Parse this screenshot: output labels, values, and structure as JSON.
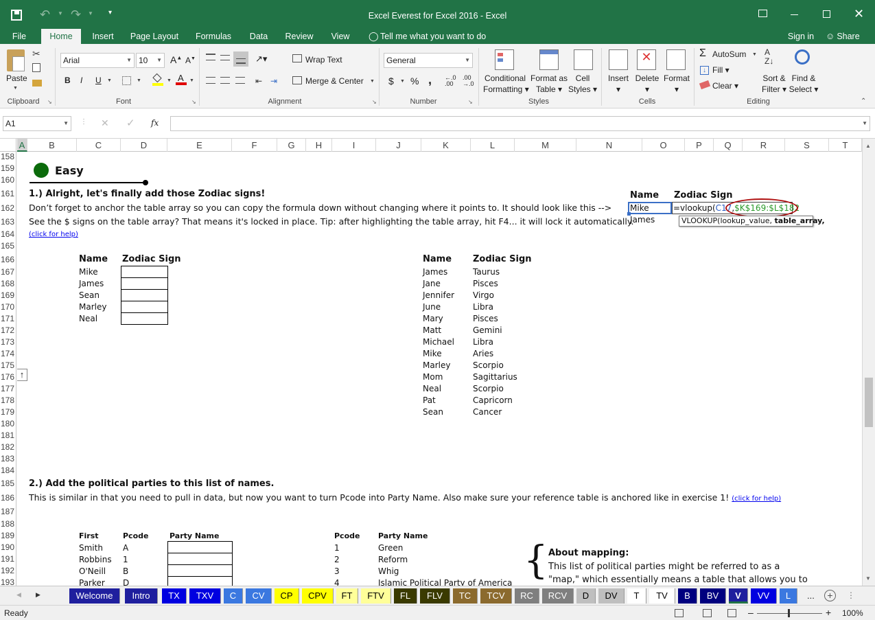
{
  "window": {
    "title": "Excel Everest for Excel 2016 - Excel"
  },
  "ribbon_tabs": [
    "File",
    "Home",
    "Insert",
    "Page Layout",
    "Formulas",
    "Data",
    "Review",
    "View"
  ],
  "tell_me": "Tell me what you want to do",
  "sign_in": "Sign in",
  "share": "Share",
  "clipboard": {
    "paste": "Paste",
    "label": "Clipboard"
  },
  "font": {
    "name": "Arial",
    "size": "10",
    "label": "Font",
    "bold": "B",
    "italic": "I",
    "underline": "U"
  },
  "alignment": {
    "wrap": "Wrap Text",
    "merge": "Merge & Center",
    "label": "Alignment"
  },
  "number": {
    "format": "General",
    "label": "Number",
    "dollar": "$",
    "percent": "%",
    "comma": ","
  },
  "styles": {
    "cond1": "Conditional",
    "cond2": "Formatting",
    "fmt1": "Format as",
    "fmt2": "Table",
    "cell1": "Cell",
    "cell2": "Styles",
    "label": "Styles"
  },
  "cells": {
    "insert": "Insert",
    "delete": "Delete",
    "format": "Format",
    "label": "Cells"
  },
  "editing": {
    "autosum": "AutoSum",
    "fill": "Fill",
    "clear": "Clear",
    "sort1": "Sort &",
    "sort2": "Filter",
    "find1": "Find &",
    "find2": "Select",
    "label": "Editing"
  },
  "formula_bar": {
    "name_box": "A1",
    "fx": "fx",
    "value": ""
  },
  "columns": [
    "A",
    "B",
    "C",
    "D",
    "E",
    "F",
    "G",
    "H",
    "I",
    "J",
    "K",
    "L",
    "M",
    "N",
    "O",
    "P",
    "Q",
    "R",
    "S",
    "T"
  ],
  "rows": [
    "158",
    "159",
    "160",
    "161",
    "162",
    "163",
    "164",
    "165",
    "166",
    "167",
    "168",
    "169",
    "170",
    "171",
    "172",
    "173",
    "174",
    "175",
    "176",
    "177",
    "178",
    "179",
    "180",
    "181",
    "182",
    "183",
    "184",
    "185",
    "186",
    "187",
    "188",
    "189",
    "190",
    "191",
    "192",
    "193"
  ],
  "content": {
    "easy": "Easy",
    "q1_title": "1.) Alright, let's finally add those Zodiac signs!",
    "q1_line1": "Don’t forget to anchor the table array so you can copy the formula down without changing where it points to. It should look like this -->",
    "q1_line2": "See the $ signs on the table array? That means it's locked in place. Tip: after highlighting the table array, hit F4... it will lock it automatically.",
    "click_help": "(click for help)",
    "example": {
      "name_hdr": "Name",
      "zodiac_hdr": "Zodiac Sign",
      "name1": "Mike",
      "name2": "James",
      "formula_a": "=vlookup(",
      "formula_b": "C17",
      "formula_c": ",",
      "formula_d": "$K$169:$L$182",
      "tooltip_a": "VLOOKUP(lookup_value, ",
      "tooltip_b": "table_array,"
    },
    "table1": {
      "name_hdr": "Name",
      "zodiac_hdr": "Zodiac Sign",
      "names": [
        "Mike",
        "James",
        "Sean",
        "Marley",
        "Neal"
      ]
    },
    "lookup1": {
      "name_hdr": "Name",
      "zodiac_hdr": "Zodiac Sign",
      "rows": [
        [
          "James",
          "Taurus"
        ],
        [
          "Jane",
          "Pisces"
        ],
        [
          "Jennifer",
          "Virgo"
        ],
        [
          "June",
          "Libra"
        ],
        [
          "Mary",
          "Pisces"
        ],
        [
          "Matt",
          "Gemini"
        ],
        [
          "Michael",
          "Libra"
        ],
        [
          "Mike",
          "Aries"
        ],
        [
          "Marley",
          "Scorpio"
        ],
        [
          "Mom",
          "Sagittarius"
        ],
        [
          "Neal",
          "Scorpio"
        ],
        [
          "Pat",
          "Capricorn"
        ],
        [
          "Sean",
          "Cancer"
        ]
      ]
    },
    "q2_title": "2.) Add the political parties to this list of names.",
    "q2_line1": "This is similar in that you need to pull in data, but now you want to turn Pcode into Party Name. Also make sure your reference table is anchored like in exercise 1!",
    "table2": {
      "first_hdr": "First",
      "pcode_hdr": "Pcode",
      "party_hdr": "Party Name",
      "rows": [
        [
          "Smith",
          "A"
        ],
        [
          "Robbins",
          "1"
        ],
        [
          "O'Neill",
          "B"
        ],
        [
          "Parker",
          "D"
        ]
      ]
    },
    "lookup2": {
      "pcode_hdr": "Pcode",
      "party_hdr": "Party Name",
      "rows": [
        [
          "1",
          "Green"
        ],
        [
          "2",
          "Reform"
        ],
        [
          "3",
          "Whig"
        ],
        [
          "4",
          "Islamic Political Party of America"
        ]
      ]
    },
    "mapping_title": "About mapping:",
    "mapping_l1": "This list of political parties might be referred to as a",
    "mapping_l2": "\"map,\" which essentially means a table that allows you to"
  },
  "sheet_tabs": [
    {
      "label": "Welcome",
      "bg": "#1f1f9e",
      "fg": "#ffffff"
    },
    {
      "label": "Intro",
      "bg": "#1f1f9e",
      "fg": "#ffffff"
    },
    {
      "label": "TX",
      "bg": "#0000e0",
      "fg": "#ffffff"
    },
    {
      "label": "TXV",
      "bg": "#0000e0",
      "fg": "#ffffff"
    },
    {
      "label": "C",
      "bg": "#3b78e0",
      "fg": "#ffffff"
    },
    {
      "label": "CV",
      "bg": "#3b78e0",
      "fg": "#ffffff"
    },
    {
      "label": "CP",
      "bg": "#ffff00",
      "fg": "#000000"
    },
    {
      "label": "CPV",
      "bg": "#ffff00",
      "fg": "#000000"
    },
    {
      "label": "FT",
      "bg": "#ffff99",
      "fg": "#000000"
    },
    {
      "label": "FTV",
      "bg": "#ffff99",
      "fg": "#000000"
    },
    {
      "label": "FL",
      "bg": "#3a3a00",
      "fg": "#ffffff"
    },
    {
      "label": "FLV",
      "bg": "#3a3a00",
      "fg": "#ffffff"
    },
    {
      "label": "TC",
      "bg": "#8b6a2e",
      "fg": "#ffffff"
    },
    {
      "label": "TCV",
      "bg": "#8b6a2e",
      "fg": "#ffffff"
    },
    {
      "label": "RC",
      "bg": "#7f7f7f",
      "fg": "#ffffff"
    },
    {
      "label": "RCV",
      "bg": "#7f7f7f",
      "fg": "#ffffff"
    },
    {
      "label": "D",
      "bg": "#bfbfbf",
      "fg": "#000000"
    },
    {
      "label": "DV",
      "bg": "#bfbfbf",
      "fg": "#000000"
    },
    {
      "label": "T",
      "bg": "#ffffff",
      "fg": "#000000"
    },
    {
      "label": "TV",
      "bg": "#ffffff",
      "fg": "#000000"
    },
    {
      "label": "B",
      "bg": "#00007f",
      "fg": "#ffffff"
    },
    {
      "label": "BV",
      "bg": "#00007f",
      "fg": "#ffffff"
    },
    {
      "label": "V",
      "bg": "#1f1f9e",
      "fg": "#ffffff"
    },
    {
      "label": "VV",
      "bg": "#0000e0",
      "fg": "#ffffff"
    },
    {
      "label": "L",
      "bg": "#3b78e0",
      "fg": "#ffffff"
    }
  ],
  "more_tabs": "...",
  "status": {
    "ready": "Ready",
    "zoom": "100%"
  }
}
